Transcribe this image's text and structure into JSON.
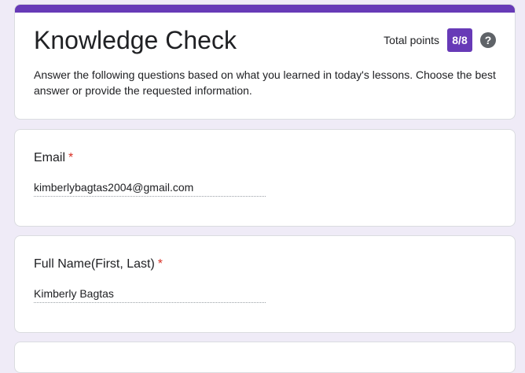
{
  "form": {
    "title": "Knowledge Check",
    "description": "Answer the following questions based on what you learned in today's lessons. Choose the best answer or provide the requested information.",
    "total_points_label": "Total points",
    "score": "8/8",
    "help_glyph": "?",
    "accent_color": "#673ab7"
  },
  "questions": [
    {
      "title": "Email",
      "required_mark": "*",
      "answer": "kimberlybagtas2004@gmail.com"
    },
    {
      "title": "Full Name(First, Last)",
      "required_mark": "*",
      "answer": "Kimberly Bagtas"
    }
  ],
  "icons": {
    "help": "help-icon"
  }
}
